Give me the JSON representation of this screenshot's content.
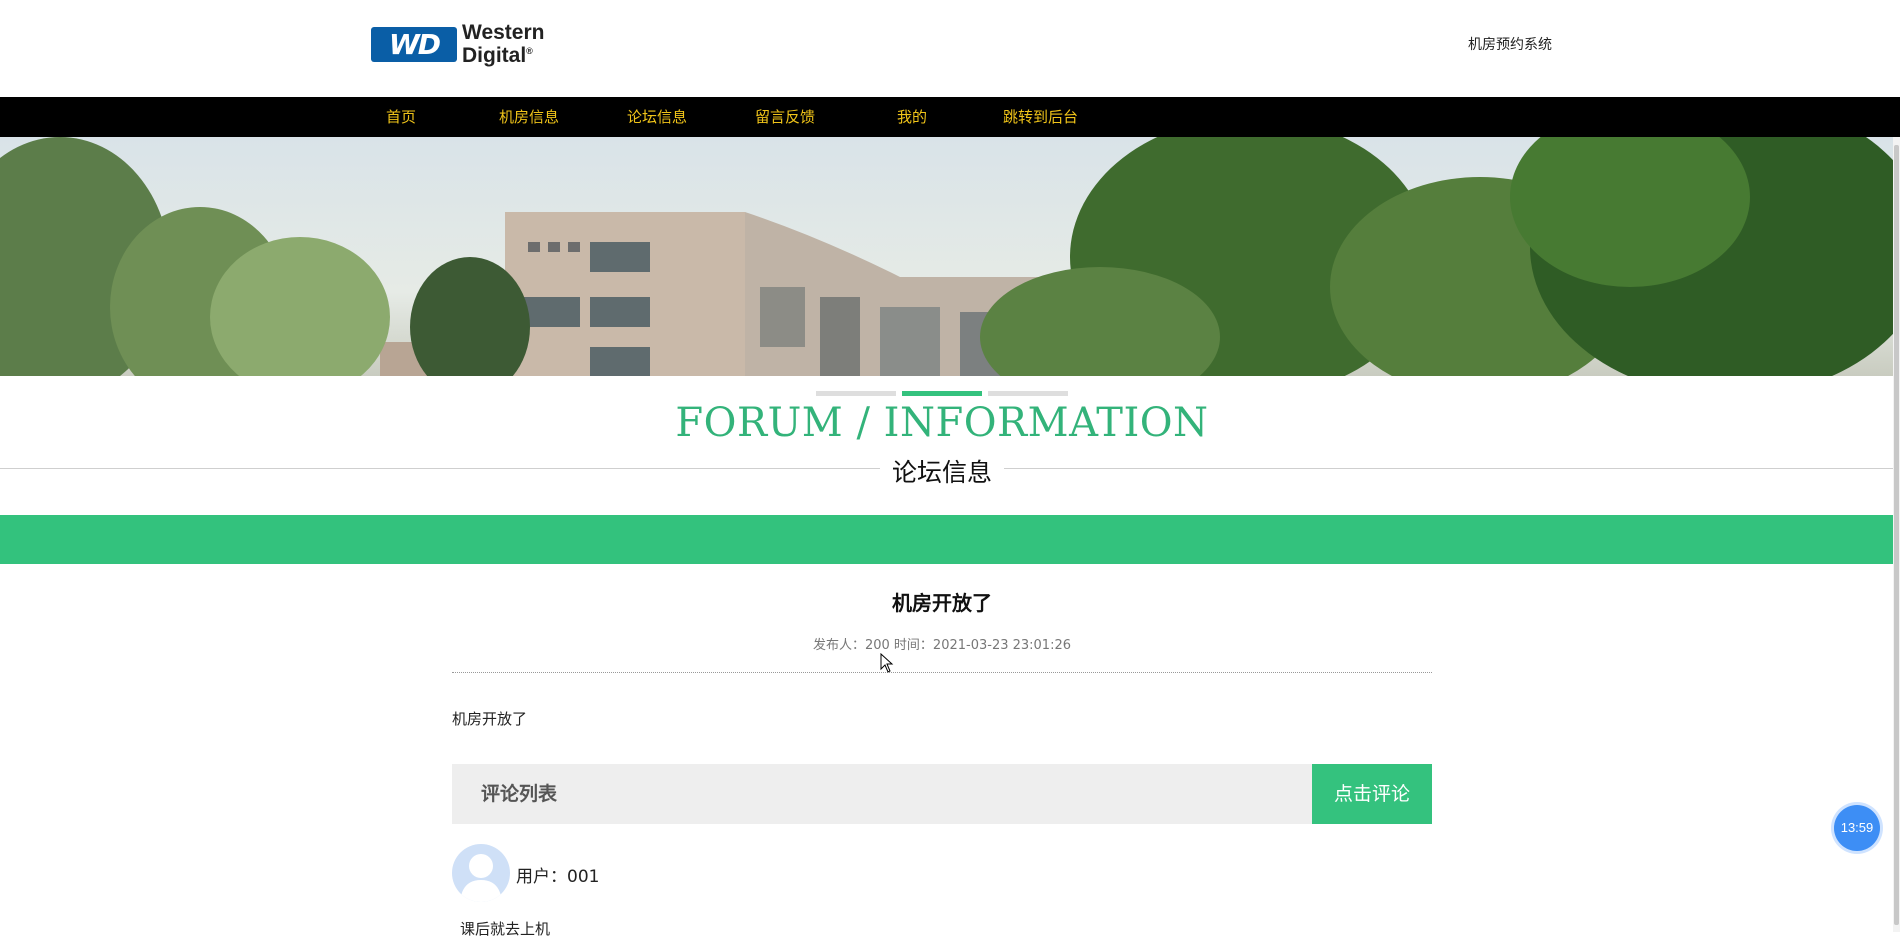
{
  "header": {
    "logo_badge": "WD",
    "logo_line1": "Western",
    "logo_line2": "Digital",
    "logo_mark": "®",
    "site_title": "机房预约系统"
  },
  "nav": {
    "items": [
      {
        "label": "首页"
      },
      {
        "label": "机房信息"
      },
      {
        "label": "论坛信息"
      },
      {
        "label": "留言反馈"
      },
      {
        "label": "我的"
      },
      {
        "label": "跳转到后台"
      }
    ]
  },
  "section": {
    "title_en": "FORUM / INFORMATION",
    "title_cn": "论坛信息"
  },
  "post": {
    "title": "机房开放了",
    "meta": "发布人：200 时间：2021-03-23 23:01:26",
    "content": "机房开放了"
  },
  "comments": {
    "header": "评论列表",
    "button": "点击评论",
    "items": [
      {
        "user": "用户：001",
        "text": "课后就去上机"
      }
    ]
  },
  "clock": {
    "time": "13:59"
  },
  "colors": {
    "accent": "#34c27e",
    "nav_bg": "#000000",
    "nav_text": "#f0c419"
  }
}
